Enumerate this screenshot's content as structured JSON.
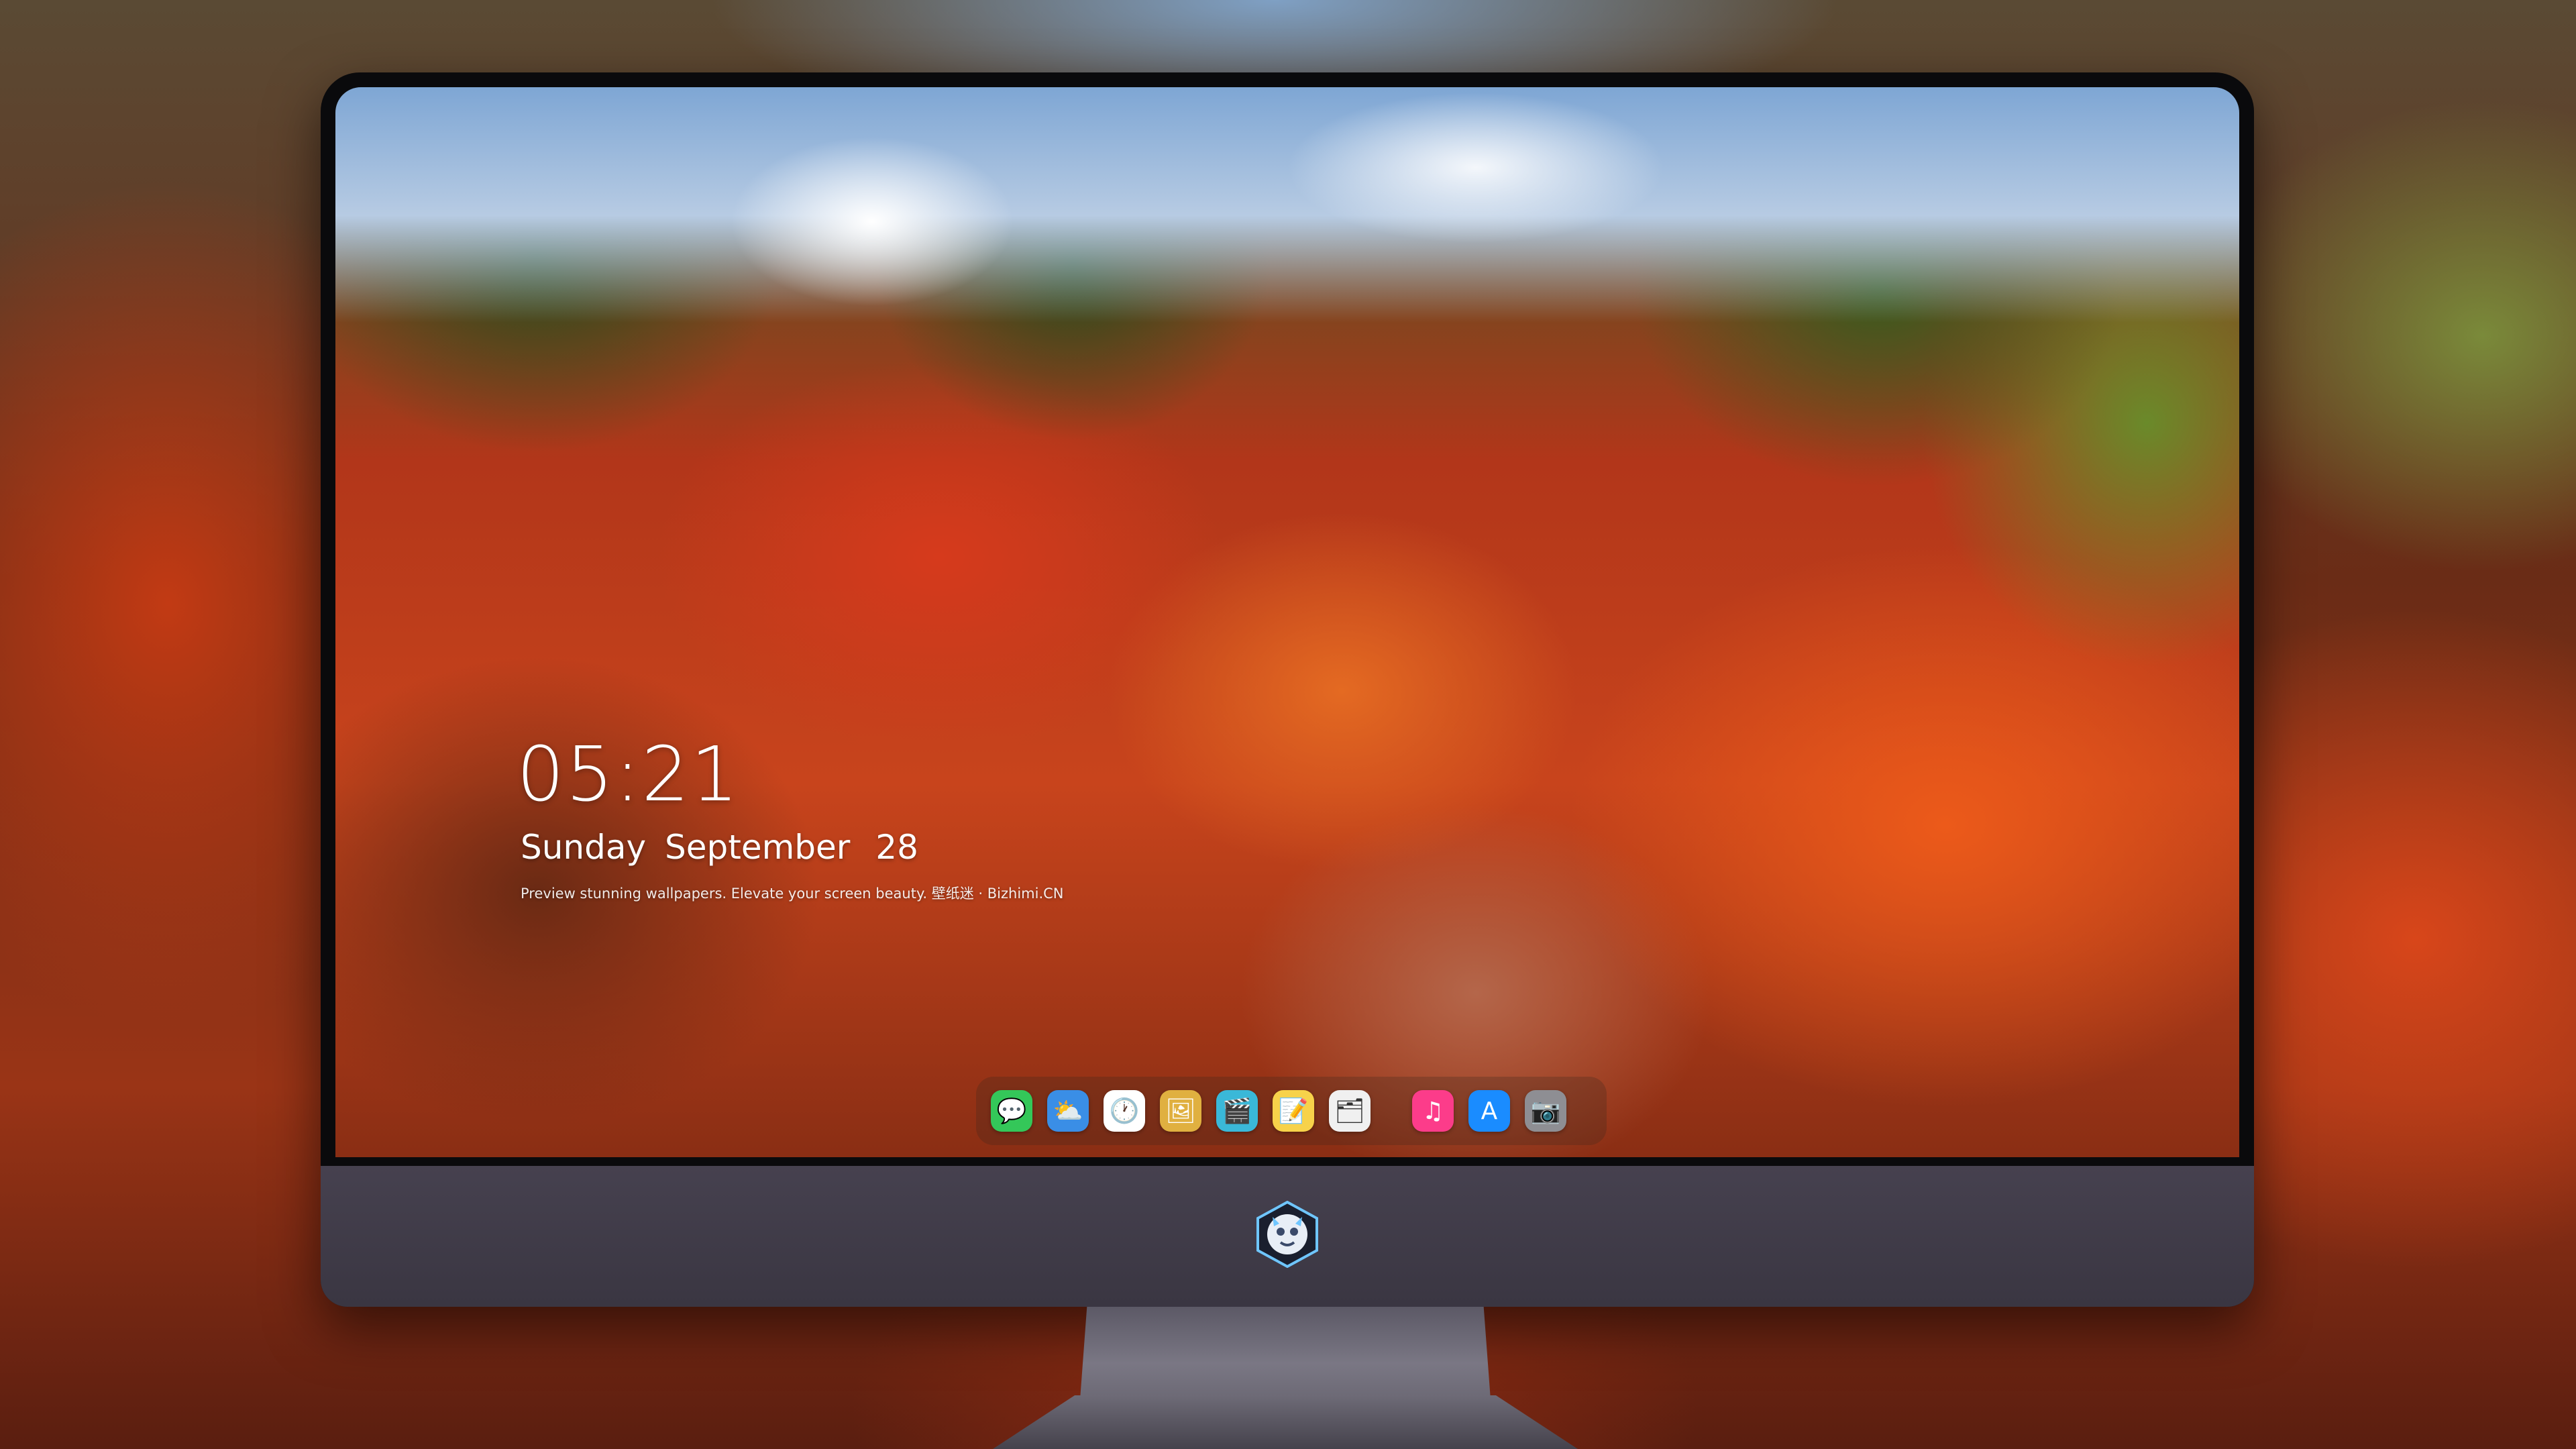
{
  "lock_screen": {
    "time": "05:21",
    "weekday": "Sunday",
    "month": "September",
    "day": "28",
    "caption": "Preview stunning wallpapers. Elevate your screen beauty. 壁纸迷 · Bizhimi.CN"
  },
  "dock": {
    "items": [
      {
        "name": "messages-icon",
        "glyph": "💬",
        "color": "#34c759"
      },
      {
        "name": "weather-icon",
        "glyph": "⛅",
        "color": "#3a8ee6"
      },
      {
        "name": "clock-icon",
        "glyph": "🕐",
        "color": "#ffffff"
      },
      {
        "name": "preview-icon",
        "glyph": "🖼",
        "color": "#e0b040"
      },
      {
        "name": "claquette-icon",
        "glyph": "🎬",
        "color": "#3ab8d8"
      },
      {
        "name": "notes-icon",
        "glyph": "📝",
        "color": "#f7d24a"
      },
      {
        "name": "photos-gallery-icon",
        "glyph": "🗂",
        "color": "#f0f0f0"
      },
      {
        "name": "music-icon",
        "glyph": "♫",
        "color": "#fc3c8a"
      },
      {
        "name": "app-store-icon",
        "glyph": "A",
        "color": "#1a8cff"
      },
      {
        "name": "camera-icon",
        "glyph": "📷",
        "color": "#8e8e93"
      }
    ]
  }
}
